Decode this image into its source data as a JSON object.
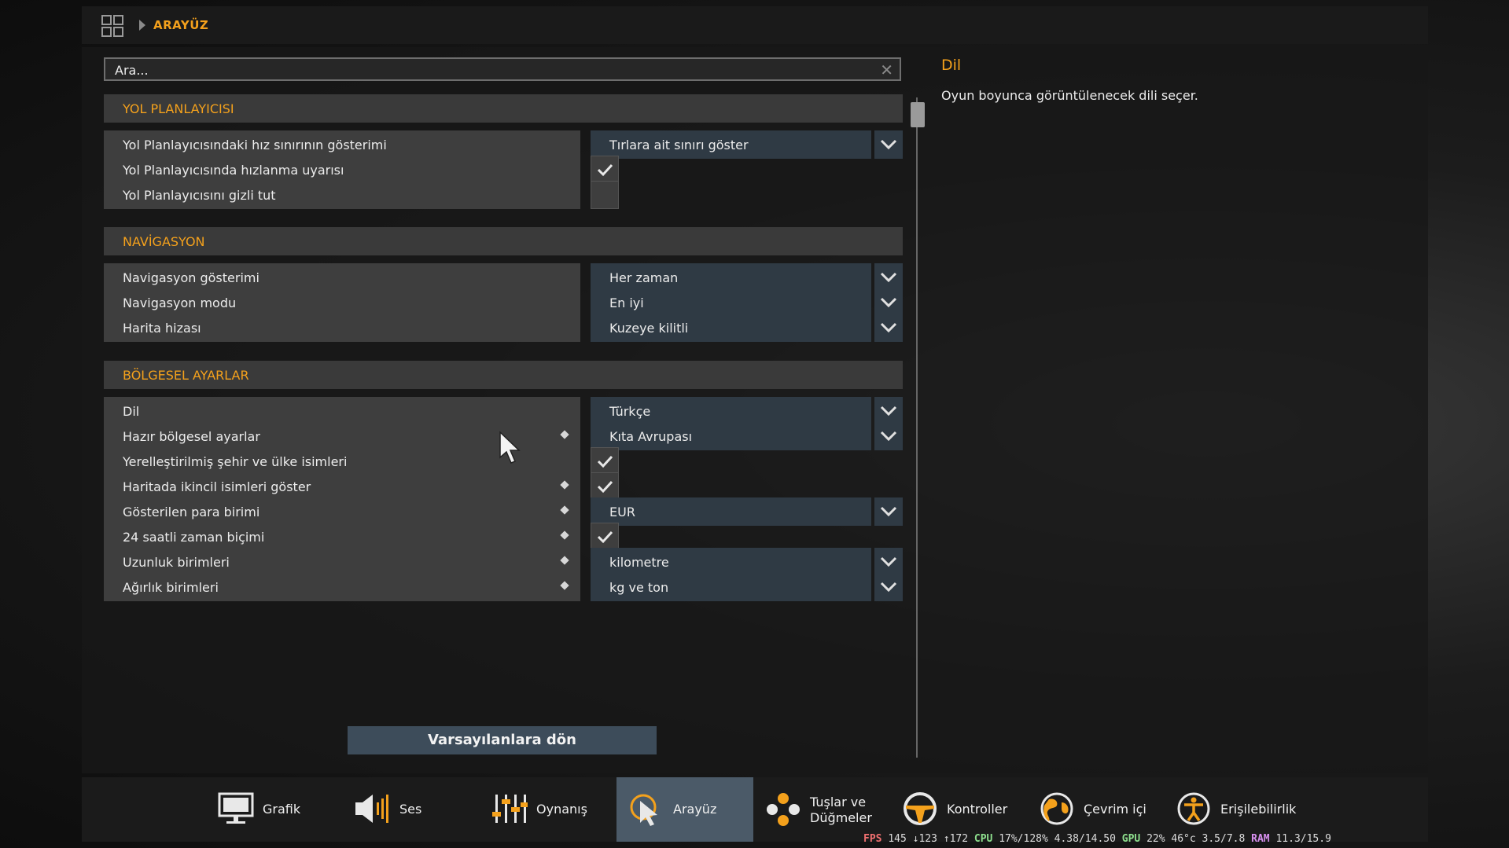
{
  "breadcrumb": {
    "current": "ARAYÜZ"
  },
  "search": {
    "value": "Ara..."
  },
  "sections": {
    "route": {
      "title": "YOL PLANLAYICISI"
    },
    "nav": {
      "title": "NAVİGASYON"
    },
    "regional": {
      "title": "BÖLGESEL AYARLAR"
    }
  },
  "rows": {
    "speed_limit": {
      "label": "Yol Planlayıcısındaki hız sınırının gösterimi",
      "value": "Tırlara ait sınırı göster"
    },
    "speed_warning": {
      "label": "Yol Planlayıcısında hızlanma uyarısı",
      "checked": true
    },
    "hide_planner": {
      "label": "Yol Planlayıcısını gizli tut",
      "checked": false
    },
    "nav_display": {
      "label": "Navigasyon gösterimi",
      "value": "Her zaman"
    },
    "nav_mode": {
      "label": "Navigasyon modu",
      "value": "En iyi"
    },
    "map_align": {
      "label": "Harita hizası",
      "value": "Kuzeye kilitli"
    },
    "language": {
      "label": "Dil",
      "value": "Türkçe"
    },
    "preset": {
      "label": "Hazır bölgesel ayarlar",
      "value": "Kıta Avrupası"
    },
    "localized_names": {
      "label": "Yerelleştirilmiş şehir ve ülke isimleri",
      "checked": true
    },
    "secondary_names": {
      "label": "Haritada ikincil isimleri göster",
      "checked": true
    },
    "currency": {
      "label": "Gösterilen para birimi",
      "value": "EUR"
    },
    "time_format": {
      "label": "24 saatli zaman biçimi",
      "checked": true
    },
    "length_units": {
      "label": "Uzunluk birimleri",
      "value": "kilometre"
    },
    "weight_units": {
      "label": "Ağırlık birimleri",
      "value": "kg ve ton"
    }
  },
  "help": {
    "title": "Dil",
    "text": "Oyun boyunca görüntülenecek dili seçer."
  },
  "reset_label": "Varsayılanlara dön",
  "tabs": [
    {
      "label": "Grafik",
      "icon": "monitor-icon"
    },
    {
      "label": "Ses",
      "icon": "speaker-icon"
    },
    {
      "label": "Oynanış",
      "icon": "sliders-icon"
    },
    {
      "label": "Arayüz",
      "icon": "cursor-icon",
      "active": true
    },
    {
      "label": "Tuşlar ve Düğmeler",
      "line1": "Tuşlar ve",
      "line2": "Düğmeler",
      "icon": "buttons-icon"
    },
    {
      "label": "Kontroller",
      "icon": "steering-wheel-icon"
    },
    {
      "label": "Çevrim içi",
      "icon": "globe-icon"
    },
    {
      "label": "Erişilebilirlik",
      "icon": "accessibility-icon"
    }
  ],
  "perf": {
    "fps_label": "FPS",
    "fps": "145 ↓123 ↑172",
    "cpu_label": "CPU",
    "cpu": "17%/128%",
    "cpu_clock": "4.38/14.50",
    "gpu_label": "GPU",
    "gpu": "22%",
    "gpu_temp": "46°c",
    "gpu_mem": "3.5/7.8",
    "ram_label": "RAM",
    "ram": "11.3/15.9"
  },
  "colors": {
    "accent": "#f4a11c",
    "active_tab": "#4b5a68",
    "dropdown_bg": "#2f3a44"
  }
}
